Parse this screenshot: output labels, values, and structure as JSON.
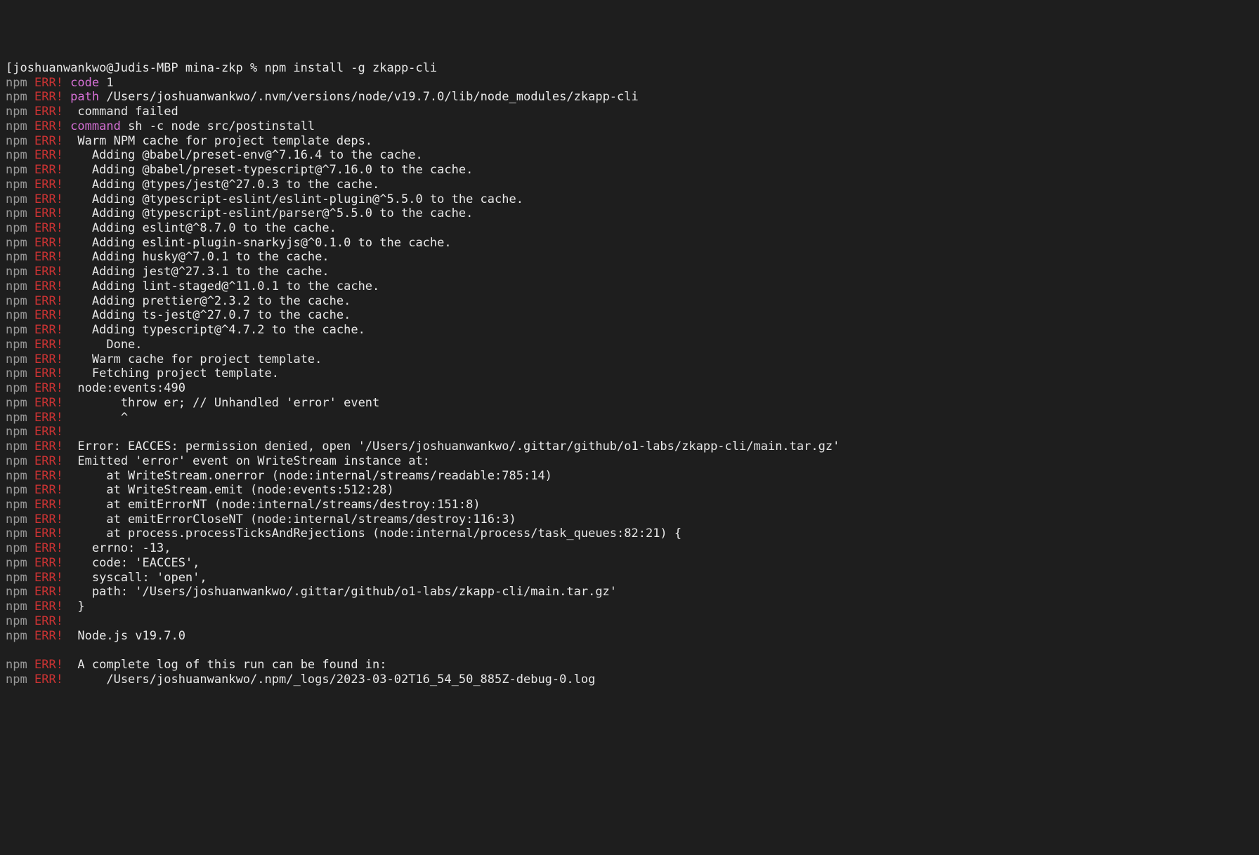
{
  "prompt": {
    "user_host": "joshuanwankwo@Judis-MBP",
    "dir": "mina-zkp",
    "symbol": "%",
    "command": "npm install -g zkapp-cli"
  },
  "labels": {
    "npm": "npm",
    "err": "ERR!"
  },
  "lines": [
    {
      "type": "kv",
      "key": "code",
      "val": " 1"
    },
    {
      "type": "kv",
      "key": "path",
      "val": " /Users/joshuanwankwo/.nvm/versions/node/v19.7.0/lib/node_modules/zkapp-cli"
    },
    {
      "type": "plain",
      "text": " command failed"
    },
    {
      "type": "kv",
      "key": "command",
      "val": " sh -c node src/postinstall"
    },
    {
      "type": "plain",
      "text": " Warm NPM cache for project template deps."
    },
    {
      "type": "plain",
      "text": "   Adding @babel/preset-env@^7.16.4 to the cache."
    },
    {
      "type": "plain",
      "text": "   Adding @babel/preset-typescript@^7.16.0 to the cache."
    },
    {
      "type": "plain",
      "text": "   Adding @types/jest@^27.0.3 to the cache."
    },
    {
      "type": "plain",
      "text": "   Adding @typescript-eslint/eslint-plugin@^5.5.0 to the cache."
    },
    {
      "type": "plain",
      "text": "   Adding @typescript-eslint/parser@^5.5.0 to the cache."
    },
    {
      "type": "plain",
      "text": "   Adding eslint@^8.7.0 to the cache."
    },
    {
      "type": "plain",
      "text": "   Adding eslint-plugin-snarkyjs@^0.1.0 to the cache."
    },
    {
      "type": "plain",
      "text": "   Adding husky@^7.0.1 to the cache."
    },
    {
      "type": "plain",
      "text": "   Adding jest@^27.3.1 to the cache."
    },
    {
      "type": "plain",
      "text": "   Adding lint-staged@^11.0.1 to the cache."
    },
    {
      "type": "plain",
      "text": "   Adding prettier@^2.3.2 to the cache."
    },
    {
      "type": "plain",
      "text": "   Adding ts-jest@^27.0.7 to the cache."
    },
    {
      "type": "plain",
      "text": "   Adding typescript@^4.7.2 to the cache."
    },
    {
      "type": "plain",
      "text": "     Done."
    },
    {
      "type": "plain",
      "text": "   Warm cache for project template."
    },
    {
      "type": "plain",
      "text": "   Fetching project template."
    },
    {
      "type": "plain",
      "text": " node:events:490"
    },
    {
      "type": "plain",
      "text": "       throw er; // Unhandled 'error' event"
    },
    {
      "type": "plain",
      "text": "       ^"
    },
    {
      "type": "plain",
      "text": ""
    },
    {
      "type": "plain",
      "text": " Error: EACCES: permission denied, open '/Users/joshuanwankwo/.gittar/github/o1-labs/zkapp-cli/main.tar.gz'"
    },
    {
      "type": "plain",
      "text": " Emitted 'error' event on WriteStream instance at:"
    },
    {
      "type": "plain",
      "text": "     at WriteStream.onerror (node:internal/streams/readable:785:14)"
    },
    {
      "type": "plain",
      "text": "     at WriteStream.emit (node:events:512:28)"
    },
    {
      "type": "plain",
      "text": "     at emitErrorNT (node:internal/streams/destroy:151:8)"
    },
    {
      "type": "plain",
      "text": "     at emitErrorCloseNT (node:internal/streams/destroy:116:3)"
    },
    {
      "type": "plain",
      "text": "     at process.processTicksAndRejections (node:internal/process/task_queues:82:21) {"
    },
    {
      "type": "plain",
      "text": "   errno: -13,"
    },
    {
      "type": "plain",
      "text": "   code: 'EACCES',"
    },
    {
      "type": "plain",
      "text": "   syscall: 'open',"
    },
    {
      "type": "plain",
      "text": "   path: '/Users/joshuanwankwo/.gittar/github/o1-labs/zkapp-cli/main.tar.gz'"
    },
    {
      "type": "plain",
      "text": " }"
    },
    {
      "type": "plain",
      "text": ""
    },
    {
      "type": "plain",
      "text": " Node.js v19.7.0"
    },
    {
      "type": "blank"
    },
    {
      "type": "plain",
      "text": " A complete log of this run can be found in:"
    },
    {
      "type": "plain",
      "text": "     /Users/joshuanwankwo/.npm/_logs/2023-03-02T16_54_50_885Z-debug-0.log"
    }
  ]
}
